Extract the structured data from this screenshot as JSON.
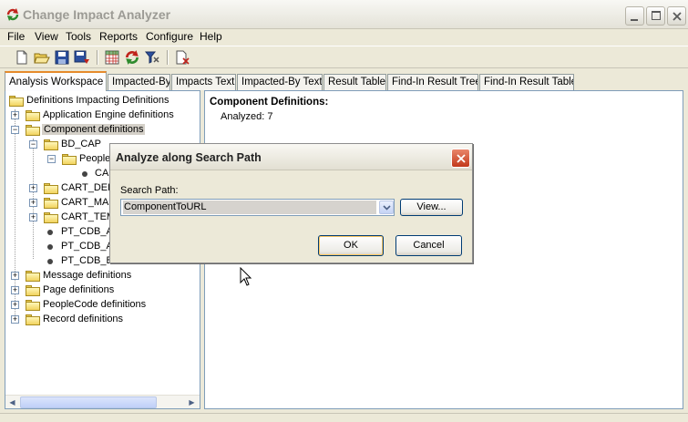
{
  "window": {
    "title": "Change Impact Analyzer"
  },
  "menu": [
    "File",
    "View",
    "Tools",
    "Reports",
    "Configure",
    "Help"
  ],
  "toolbar_icons": [
    "new-document-icon",
    "open-folder-icon",
    "save-icon",
    "save-as-icon",
    "grid-icon",
    "refresh-icon",
    "filter-icon",
    "document-delete-icon"
  ],
  "tabs": [
    {
      "label": "Analysis Workspace",
      "active": true
    },
    {
      "label": "Impacted-By",
      "active": false
    },
    {
      "label": "Impacts Text",
      "active": false
    },
    {
      "label": "Impacted-By Text",
      "active": false
    },
    {
      "label": "Result Table",
      "active": false
    },
    {
      "label": "Find-In Result Tree",
      "active": false
    },
    {
      "label": "Find-In Result Table",
      "active": false
    }
  ],
  "tree": {
    "root": "Definitions Impacting Definitions",
    "app_engine": "Application Engine definitions",
    "component": "Component definitions",
    "bd_cap": "BD_CAP",
    "people": "People",
    "ca": "CA",
    "cart_del": "CART_DEL",
    "cart_mas": "CART_MAS",
    "cart_tem": "CART_TEM",
    "pt_cdb_a1": "PT_CDB_A",
    "pt_cdb_a2": "PT_CDB_A",
    "pt_cdb_b": "PT_CDB_B",
    "message": "Message definitions",
    "page": "Page definitions",
    "peoplecode": "PeopleCode definitions",
    "record": "Record definitions"
  },
  "content": {
    "title": "Component Definitions:",
    "analyzed": "Analyzed: 7"
  },
  "dialog": {
    "title": "Analyze along Search Path",
    "search_path_label": "Search Path:",
    "search_path_value": "ComponentToURL",
    "view_label": "View...",
    "ok_label": "OK",
    "cancel_label": "Cancel"
  },
  "colors": {
    "window_bg": "#ece9d8",
    "active_tab_accent": "#e68b2c",
    "dialog_close": "#c2391c",
    "pane_border": "#7f9db9"
  }
}
